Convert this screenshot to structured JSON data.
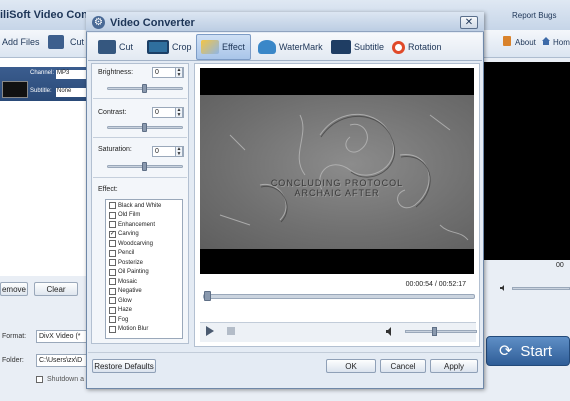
{
  "app": {
    "title": "iliSoft Video Conve",
    "report_bugs": "Report Bugs",
    "toolbar": {
      "add_files": "Add Files",
      "cut": "Cut",
      "about": "About",
      "home": "Home"
    },
    "file": {
      "channel_label": "Channel:",
      "channel_value": "MP3",
      "subtitle_label": "Subtitle:",
      "subtitle_value": "None"
    },
    "buttons": {
      "remove": "emove",
      "clear": "Clear",
      "start": "Start"
    },
    "format_label": "Format:",
    "format_value": "DivX Video (*",
    "folder_label": "Folder:",
    "folder_value": "C:\\Users\\zx\\D",
    "shutdown_label": "Shutdown a",
    "right_time": "00"
  },
  "dialog": {
    "title": "Video Converter",
    "close_glyph": "✕",
    "tabs": [
      {
        "label": "Cut",
        "icon": "cut-icon"
      },
      {
        "label": "Crop",
        "icon": "crop-icon"
      },
      {
        "label": "Effect",
        "icon": "effect-icon"
      },
      {
        "label": "WaterMark",
        "icon": "watermark-icon"
      },
      {
        "label": "Subtitle",
        "icon": "subtitle-icon"
      },
      {
        "label": "Rotation",
        "icon": "rotation-icon"
      }
    ],
    "active_tab": "Effect",
    "settings": {
      "brightness": {
        "label": "Brightness:",
        "value": "0"
      },
      "contrast": {
        "label": "Contrast:",
        "value": "0"
      },
      "saturation": {
        "label": "Saturation:",
        "value": "0"
      },
      "effect_label": "Effect:"
    },
    "effects": [
      {
        "label": "Black and White",
        "checked": false
      },
      {
        "label": "Old Film",
        "checked": false
      },
      {
        "label": "Enhancement",
        "checked": false
      },
      {
        "label": "Carving",
        "checked": true
      },
      {
        "label": "Woodcarving",
        "checked": false
      },
      {
        "label": "Pencil",
        "checked": false
      },
      {
        "label": "Posterize",
        "checked": false
      },
      {
        "label": "Oil Painting",
        "checked": false
      },
      {
        "label": "Mosaic",
        "checked": false
      },
      {
        "label": "Negative",
        "checked": false
      },
      {
        "label": "Glow",
        "checked": false
      },
      {
        "label": "Haze",
        "checked": false
      },
      {
        "label": "Fog",
        "checked": false
      },
      {
        "label": "Motion Blur",
        "checked": false
      }
    ],
    "video_caption_line1": "CONCLUDING PROTOCOL",
    "video_caption_line2": "ARCHAIC AFTER",
    "time_display": "00:00:54 / 00:52:17",
    "restore_defaults": "Restore Defaults",
    "ok": "OK",
    "cancel": "Cancel",
    "apply": "Apply"
  }
}
